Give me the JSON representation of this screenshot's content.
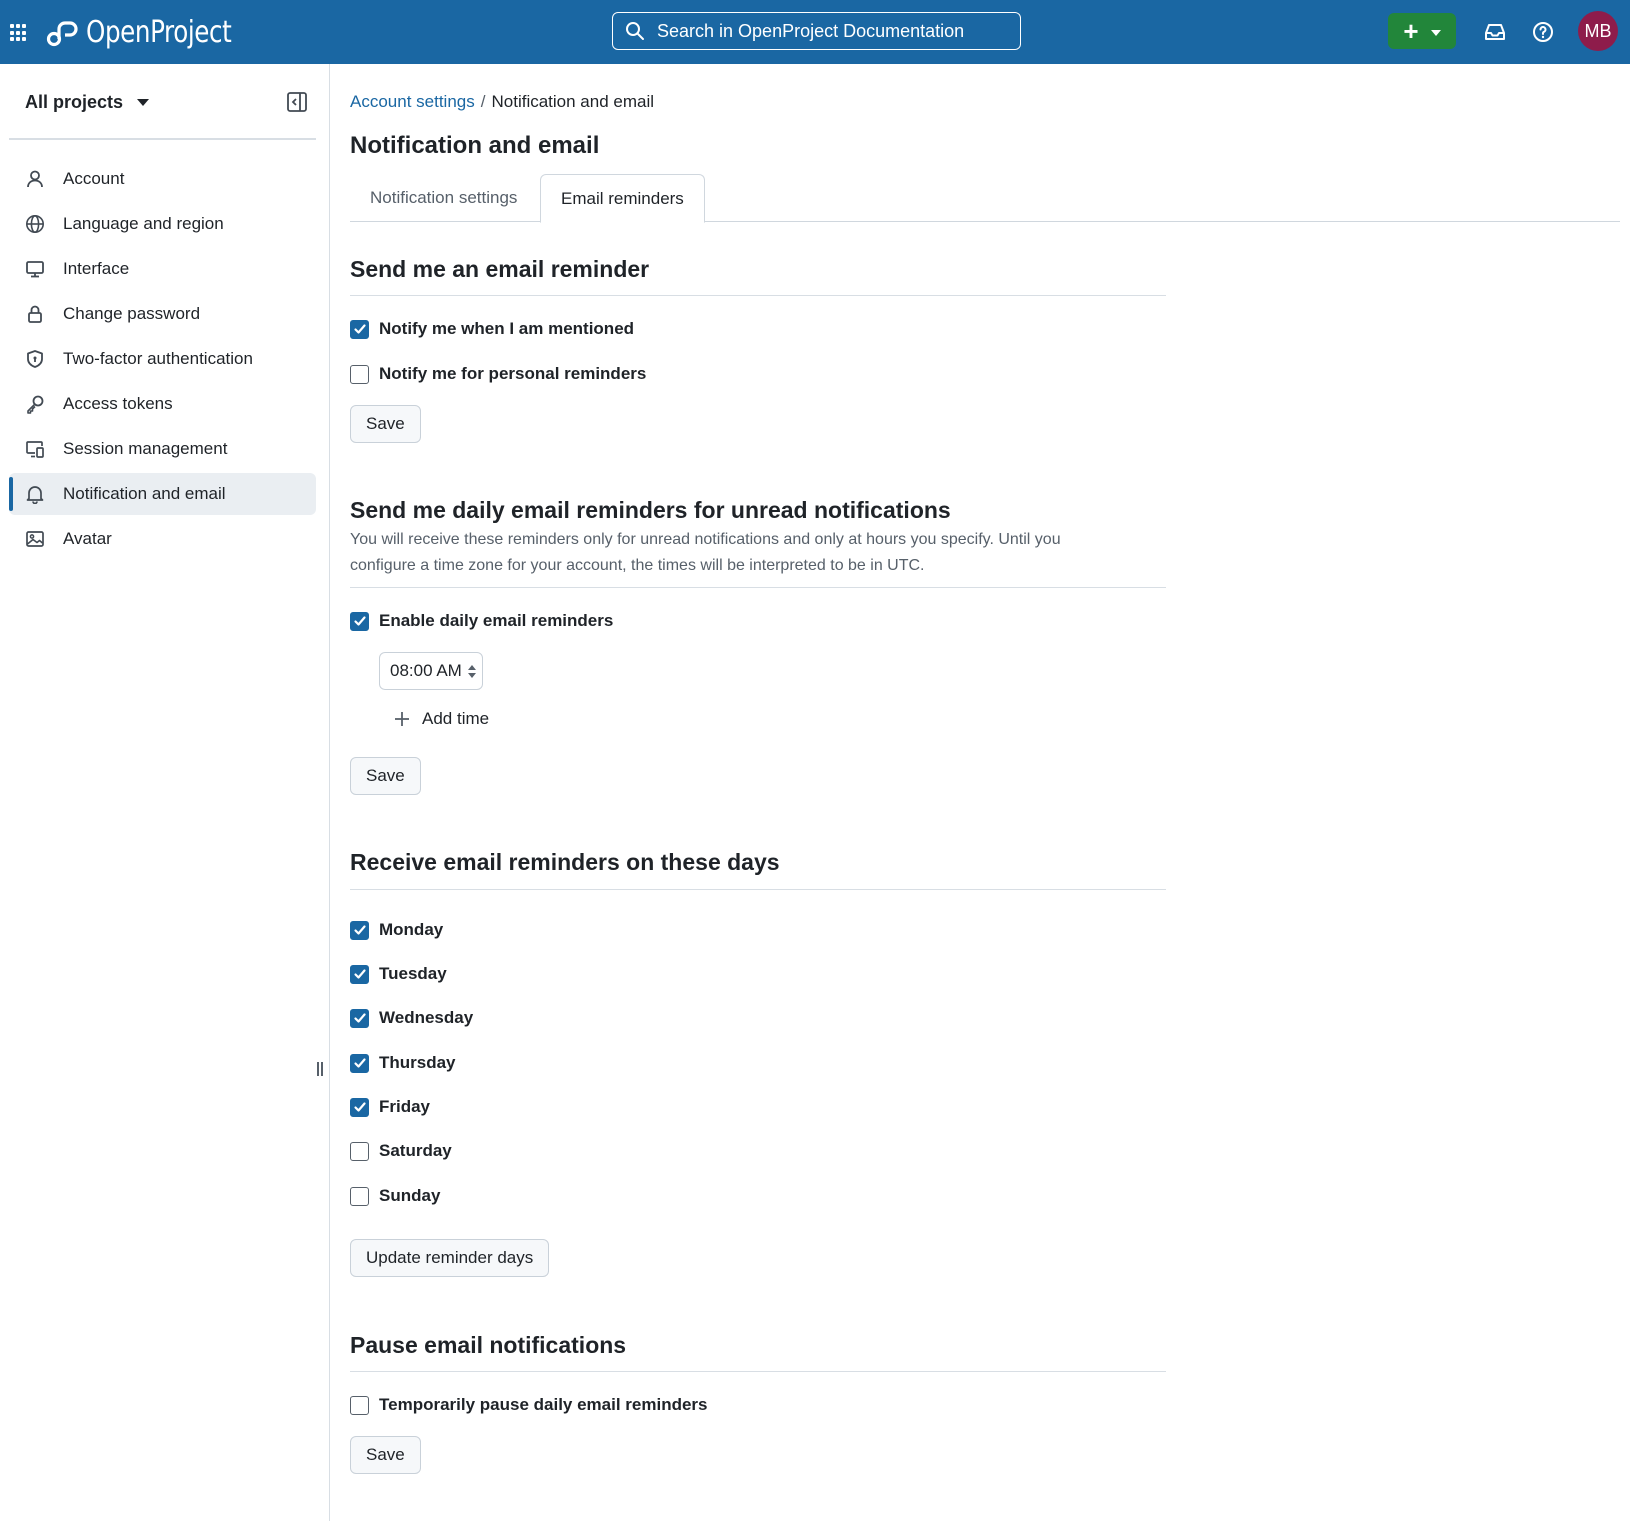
{
  "header": {
    "logo_text": "OpenProject",
    "search_placeholder": "Search in OpenProject Documentation",
    "avatar_initials": "MB",
    "create_label": "+"
  },
  "sidebar": {
    "project_selector": "All projects",
    "items": [
      {
        "label": "Account",
        "icon": "person-icon"
      },
      {
        "label": "Language and region",
        "icon": "globe-icon"
      },
      {
        "label": "Interface",
        "icon": "monitor-icon"
      },
      {
        "label": "Change password",
        "icon": "lock-icon"
      },
      {
        "label": "Two-factor authentication",
        "icon": "shield-icon"
      },
      {
        "label": "Access tokens",
        "icon": "key-icon"
      },
      {
        "label": "Session management",
        "icon": "devices-icon"
      },
      {
        "label": "Notification and email",
        "icon": "bell-icon",
        "active": true
      },
      {
        "label": "Avatar",
        "icon": "image-icon"
      }
    ]
  },
  "main": {
    "breadcrumb": {
      "parent": "Account settings",
      "separator": "/",
      "current": "Notification and email"
    },
    "title": "Notification and email",
    "tabs": [
      {
        "label": "Notification settings",
        "active": false
      },
      {
        "label": "Email reminders",
        "active": true
      }
    ],
    "section1": {
      "title": "Send me an email reminder",
      "options": [
        {
          "label": "Notify me when I am mentioned",
          "checked": true
        },
        {
          "label": "Notify me for personal reminders",
          "checked": false
        }
      ],
      "save_label": "Save"
    },
    "section2": {
      "title": "Send me daily email reminders for unread notifications",
      "description": "You will receive these reminders only for unread notifications and only at hours you specify. Until you configure a time zone for your account, the times will be interpreted to be in UTC.",
      "enable": {
        "label": "Enable daily email reminders",
        "checked": true
      },
      "time_value": "08:00 AM",
      "add_time_label": "Add time",
      "save_label": "Save"
    },
    "section3": {
      "title": "Receive email reminders on these days",
      "days": [
        {
          "label": "Monday",
          "checked": true
        },
        {
          "label": "Tuesday",
          "checked": true
        },
        {
          "label": "Wednesday",
          "checked": true
        },
        {
          "label": "Thursday",
          "checked": true
        },
        {
          "label": "Friday",
          "checked": true
        },
        {
          "label": "Saturday",
          "checked": false
        },
        {
          "label": "Sunday",
          "checked": false
        }
      ],
      "update_label": "Update reminder days"
    },
    "section4": {
      "title": "Pause email notifications",
      "pause": {
        "label": "Temporarily pause daily email reminders",
        "checked": false
      },
      "save_label": "Save"
    }
  },
  "colors": {
    "header_bg": "#1a67a3",
    "accent": "#1a67a3",
    "create_button": "#22863a",
    "avatar_bg": "#8e1c4b"
  }
}
